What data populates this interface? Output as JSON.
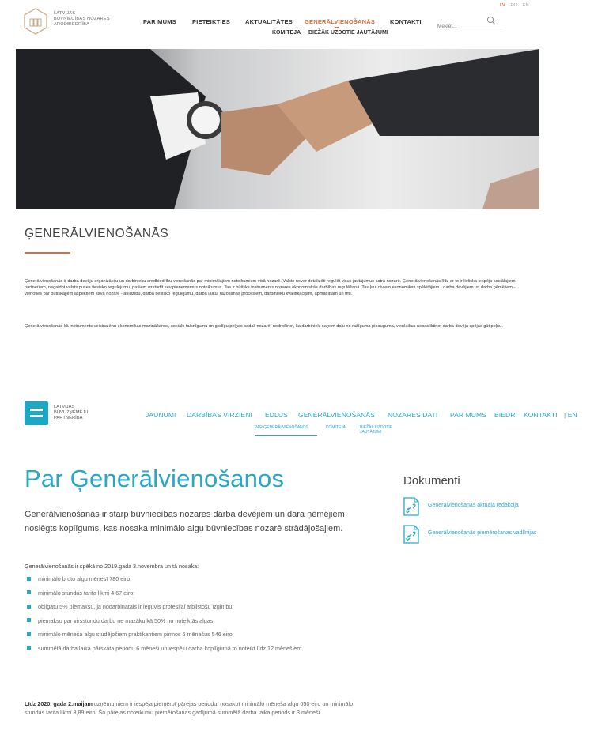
{
  "site1": {
    "logo_text": [
      "LATVIJAS",
      "BŪVNIECĪBAS NOZARES",
      "ARODBIEDRĪBA"
    ],
    "nav": [
      "PAR MUMS",
      "PIETEIKTIES",
      "AKTUALITĀTES",
      "ĢENERĀLVIENOŠANĀS",
      "KONTAKTI"
    ],
    "subnav": [
      "KOMITEJA",
      "BIEŽĀK UZDOTIE JAUTĀJUMI"
    ],
    "search_placeholder": "Meklēt...",
    "languages": [
      "LV",
      "RU",
      "EN"
    ],
    "page_title": "ĢENERĀLVIENOŠANĀS",
    "paragraphs": [
      "Ģenerālvienošanās ir darba devēju organizāciju un darbinieku arodbiedrību vienošanās par minimālajiem noteikumiem visā nozarē. Valsts nevar detalizēti regulēt visus jautājumus katrā nozarē. Ģenerālvienošanās līdz ar to ir lieliska iespēja sociālajiem partneriem, negaidot valsts puses tiesisko regulējumu, pašiem uzstādīt sev pieņemamus noteikumus. Tas ir būtisks instruments nozares ekonomiskās darbības regulēšanā. Tas ļauj diviem ekonomikas spēlētājiem - darba devējiem un darba ņēmējiem - vienoties par būtiskajiem aspektiem savā nozarē - atlīdzību, darba tiesisko regulējumu, darba laiku, ražošanas procesiem, darbinieku kvalifikācijām, apmācībām un tml.",
      "Ģenerālvienošanās kā instruments veicina ēnu ekonomikas mazināšanos, sociālo taisnīgumu un godīgu peļņas sadali nozarē, nodrošinot, ka darbinieki saņem daļu no ražīguma pieauguma, vienlaikus nepasliktinot darba devēja spējas gūt peļņu."
    ]
  },
  "site2": {
    "logo_text": [
      "LATVIJAS",
      "BŪVUZŅĒMĒJU",
      "PARTNERĪBA"
    ],
    "nav": [
      "JAUNUMI",
      "DARBĪBAS VIRZIENI",
      "EDLUS",
      "ĢENERĀLVIENOŠANĀS",
      "NOZARES DATI",
      "PAR MUMS",
      "BIEDRI",
      "KONTAKTI",
      "| EN"
    ],
    "subnav": [
      "PAR ĢENERĀLVIENOŠANOS",
      "KOMITEJA",
      "BIEŽĀK UZDOTIE JAUTĀJUMI"
    ],
    "page_title": "Par Ģenerālvienošanos",
    "lead": "Ģenerālvienošanās ir starp būvniecības nozares darba devējiem un dara ņēmējiem noslēgts koplīgums, kas nosaka minimālo algu būvniecības nozarē strādājošajiem.",
    "intro": "Ģenerālvienošanās ir spēkā no 2019.gada 3.novembra un tā nosaka:",
    "list": [
      "minimālo bruto algu mēnesī 780 eiro;",
      " minimālo stundas tarifa likmi 4,67 eiro;",
      "obligātu 5% piemaksu, ja nodarbinātais ir ieguvis profesijai atbilstošu izglītību;",
      "piemaksu par virsstundu darbu ne mazāku kā 50% no noteiktās algas;",
      "minimālo mēneša algu studējošiem praktikantiem pirmos 6 mēnešus 546 eiro;",
      "summētā darba laika pārskata periodu 6 mēneši un iespēju darba koplīgumā to noteikt līdz 12 mēnešiem."
    ],
    "transition_bold": "Līdz 2020. gada 2.maijam",
    "transition_rest": " uzņēmumiem ir iespēja piemērot pārejas periodu, nosakot minimālo mēneša algu 650 eiro un minimālo stundas tarifa likmi 3,89 eiro. Šo pārejas noteikumu piemērošanas gadījumā summētā darba laika periods ir 3 mēneši.",
    "docs_title": "Dokumenti",
    "docs": [
      "Ģenerālvienošanās aktuālā redakcija",
      "Ģenerālvienošanās piemērošanas vadlīnijas"
    ]
  },
  "colors": {
    "orange_accent": "#e06a3b",
    "teal_accent": "#29a7c7",
    "teal_logo": "#1ba8c5"
  }
}
